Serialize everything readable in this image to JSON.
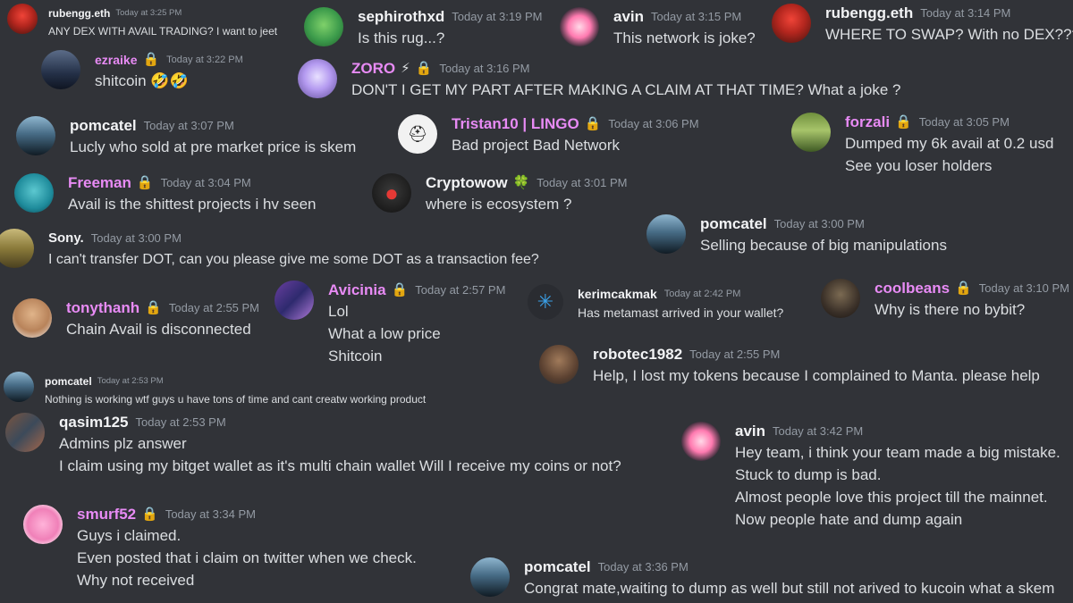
{
  "messages": {
    "m1": {
      "name": "rubengg.eth",
      "time": "Today at 3:25 PM",
      "lines": [
        "ANY DEX WITH AVAIL TRADING?  I want to jeet"
      ],
      "name_color": "#f2f3f5"
    },
    "m2": {
      "name": "sephirothxd",
      "time": "Today at 3:19 PM",
      "lines": [
        "Is this rug...?"
      ],
      "name_color": "#f2f3f5"
    },
    "m3": {
      "name": "avin",
      "time": "Today at 3:15 PM",
      "lines": [
        "This network is joke?"
      ],
      "name_color": "#f2f3f5"
    },
    "m4": {
      "name": "rubengg.eth",
      "time": "Today at 3:14 PM",
      "lines": [
        "WHERE TO SWAP? With no DEX????"
      ],
      "name_color": "#f2f3f5"
    },
    "m5": {
      "name": "ezraike",
      "time": "Today at 3:22 PM",
      "lines": [
        "shitcoin 🤣🤣"
      ],
      "name_color": "#e88bf5"
    },
    "m6": {
      "name": "ZORO",
      "time": "Today at 3:16 PM",
      "lines": [
        "DON'T I GET MY PART AFTER MAKING A CLAIM AT THAT TIME?  What a joke ?"
      ],
      "name_color": "#e88bf5"
    },
    "m7": {
      "name": "pomcatel",
      "time": "Today at 3:07 PM",
      "lines": [
        "Lucly who sold at pre market price is skem"
      ],
      "name_color": "#f2f3f5"
    },
    "m8": {
      "name": "Tristan10 | LINGO",
      "time": "Today at 3:06 PM",
      "lines": [
        "Bad project Bad Network"
      ],
      "name_color": "#e88bf5"
    },
    "m9": {
      "name": "forzali",
      "time": "Today at 3:05 PM",
      "lines": [
        "Dumped my 6k avail at 0.2 usd",
        "",
        "See you loser holders"
      ],
      "name_color": "#e88bf5"
    },
    "m10": {
      "name": "Freeman",
      "time": "Today at 3:04 PM",
      "lines": [
        "Avail is the shittest projects i hv seen"
      ],
      "name_color": "#e88bf5"
    },
    "m11": {
      "name": "Cryptowow",
      "time": "Today at 3:01 PM",
      "lines": [
        "where is ecosystem ?"
      ],
      "name_color": "#f2f3f5"
    },
    "m12": {
      "name": "pomcatel",
      "time": "Today at 3:00 PM",
      "lines": [
        "Selling because of big manipulations"
      ],
      "name_color": "#f2f3f5"
    },
    "m13": {
      "name": "Sony.",
      "time": "Today at 3:00 PM",
      "lines": [
        "I can't transfer DOT, can you please give me some DOT as a transaction fee?"
      ],
      "name_color": "#f2f3f5"
    },
    "m14": {
      "name": "tonythanh",
      "time": "Today at 2:55 PM",
      "lines": [
        "Chain Avail is disconnected"
      ],
      "name_color": "#e88bf5"
    },
    "m15": {
      "name": "Avicinia",
      "time": "Today at 2:57 PM",
      "lines": [
        "Lol",
        "What a low price",
        "Shitcoin"
      ],
      "name_color": "#e88bf5"
    },
    "m16": {
      "name": "kerimcakmak",
      "time": "Today at 2:42 PM",
      "lines": [
        "Has metamast arrived in your wallet?"
      ],
      "name_color": "#f2f3f5"
    },
    "m17": {
      "name": "coolbeans",
      "time": "Today at 3:10 PM",
      "lines": [
        "Why is there no bybit?"
      ],
      "name_color": "#e88bf5"
    },
    "m18": {
      "name": "robotec1982",
      "time": "Today at 2:55 PM",
      "lines": [
        "Help, I lost my tokens because I complained to Manta. please help"
      ],
      "name_color": "#f2f3f5"
    },
    "m19": {
      "name": "pomcatel",
      "time": "Today at 2:53 PM",
      "lines": [
        "Nothing is working wtf guys u have tons of time and cant creatw working product"
      ],
      "name_color": "#f2f3f5"
    },
    "m20": {
      "name": "qasim125",
      "time": "Today at 2:53 PM",
      "lines": [
        "Admins plz answer",
        "I claim using my bitget wallet as it's multi chain wallet Will I receive my coins or not?"
      ],
      "name_color": "#f2f3f5"
    },
    "m21": {
      "name": "avin",
      "time": "Today at 3:42 PM",
      "lines": [
        "Hey team, i think your team made a big mistake.",
        "Stuck to dump is bad.",
        "Almost people love this project till the mainnet.",
        "Now people hate and dump again"
      ],
      "name_color": "#f2f3f5"
    },
    "m22": {
      "name": "smurf52",
      "time": "Today at 3:34 PM",
      "lines": [
        "Guys i claimed.",
        "Even posted that i claim on twitter when we check.",
        "Why not received"
      ],
      "name_color": "#e88bf5"
    },
    "m23": {
      "name": "pomcatel",
      "time": "Today at 3:36 PM",
      "lines": [
        "Congrat mate,waiting to dump as well but still not arived to kucoin what a skem"
      ],
      "name_color": "#f2f3f5"
    }
  },
  "badges": {
    "lock": "🔒",
    "bolt": "⚡",
    "clover": "🍀"
  },
  "icons": {
    "helmet": "helmet-icon",
    "network": "network-icon"
  }
}
